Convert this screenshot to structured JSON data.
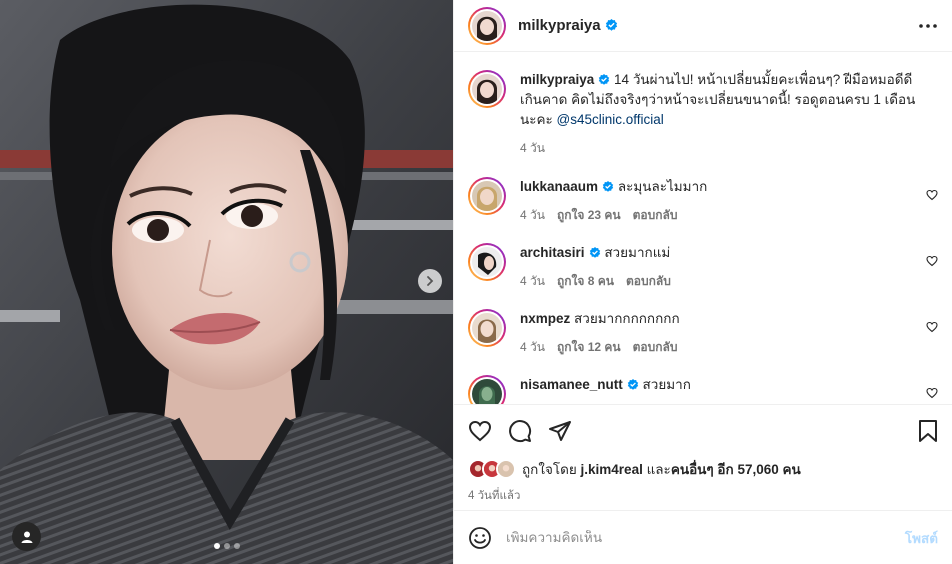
{
  "header": {
    "username": "milkypraiya",
    "verified": true,
    "more_icon": "more-horizontal-icon"
  },
  "caption": {
    "username": "milkypraiya",
    "text_pre": " 14 วันผ่านไป! หน้าเปลี่ยนมั้ยคะเพื่อนๆ? ฝีมือหมอดีดีเกินคาด คิดไม่ถึงจริงๆว่าหน้าจะเปลี่ยนขนาดนี้! รอดูตอนครบ 1 เดือนนะคะ ",
    "mention": "@s45clinic.official",
    "time": "4 วัน"
  },
  "comments": [
    {
      "username": "lukkanaaum",
      "verified": true,
      "text": "ละมุนละไมมาก",
      "time": "4 วัน",
      "likes": "ถูกใจ 23 คน",
      "reply": "ตอบกลับ"
    },
    {
      "username": "architasiri",
      "verified": true,
      "text": "สวยมากแม่",
      "time": "4 วัน",
      "likes": "ถูกใจ 8 คน",
      "reply": "ตอบกลับ"
    },
    {
      "username": "nxmpez",
      "verified": false,
      "text": "สวยมากกกกกกกก",
      "time": "4 วัน",
      "likes": "ถูกใจ 12 คน",
      "reply": "ตอบกลับ"
    },
    {
      "username": "nisamanee_nutt",
      "verified": true,
      "text": "สวยมาก",
      "time": "",
      "likes": "",
      "reply": ""
    }
  ],
  "likes": {
    "prefix": "ถูกใจโดย ",
    "user": "j.kim4real",
    "middle": " และ",
    "others": "คนอื่นๆ อีก 57,060 คน"
  },
  "posted": "4 วันที่แล้ว",
  "add_comment": {
    "placeholder": "เพิ่มความคิดเห็น",
    "post_label": "โพสต์"
  },
  "carousel": {
    "slide_count": 3,
    "active_index": 0
  },
  "colors": {
    "verified": "#0095f6",
    "mention": "#00376b",
    "post_button": "#b3dbff",
    "muted": "#737373"
  }
}
